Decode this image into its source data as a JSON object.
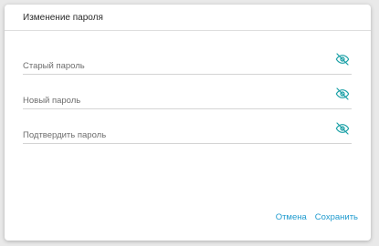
{
  "dialog": {
    "title": "Изменение пароля"
  },
  "fields": [
    {
      "label": "Старый пароль",
      "value": "",
      "icon": "eye-slash-icon"
    },
    {
      "label": "Новый пароль",
      "value": "",
      "icon": "eye-slash-icon"
    },
    {
      "label": "Подтвердить пароль",
      "value": "",
      "icon": "eye-slash-icon"
    }
  ],
  "actions": {
    "cancel_label": "Отмена",
    "save_label": "Сохранить"
  },
  "colors": {
    "accent": "#1f9bcf",
    "icon": "#1aa0a6"
  }
}
